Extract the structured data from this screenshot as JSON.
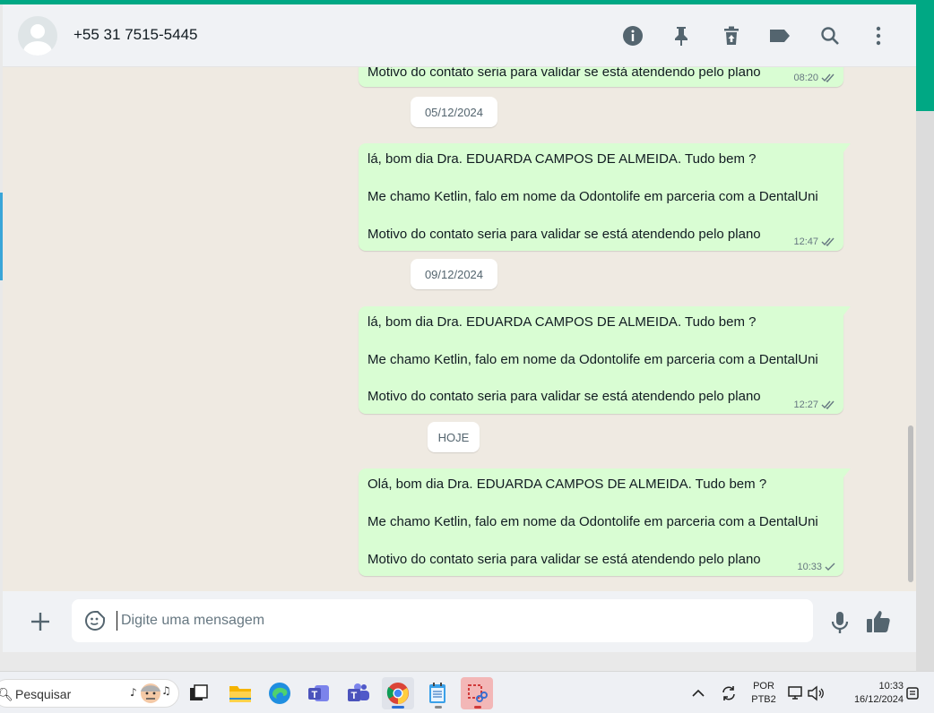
{
  "header": {
    "contact": "+55 31 7515-5445",
    "icons": [
      "info-icon",
      "pin-icon",
      "delete-icon",
      "label-icon",
      "search-icon",
      "more-icon"
    ]
  },
  "chat": {
    "partial_message": {
      "text": "Motivo do contato seria para validar se está atendendo pelo plano",
      "time": "08:20"
    },
    "groups": [
      {
        "date": "05/12/2024",
        "lines": [
          "lá, bom dia Dra. EDUARDA CAMPOS DE ALMEIDA. Tudo bem ?",
          "Me chamo Ketlin, falo em nome da Odontolife em parceria com a DentalUni",
          "Motivo do contato seria para validar se está atendendo pelo plano"
        ],
        "time": "12:47",
        "status": "read"
      },
      {
        "date": "09/12/2024",
        "lines": [
          "lá, bom dia Dra. EDUARDA CAMPOS DE ALMEIDA. Tudo bem ?",
          "Me chamo Ketlin, falo em nome da Odontolife em parceria com a DentalUni",
          "Motivo do contato seria para validar se está atendendo pelo plano"
        ],
        "time": "12:27",
        "status": "read"
      },
      {
        "date": "HOJE",
        "lines": [
          "Olá, bom dia Dra. EDUARDA CAMPOS DE ALMEIDA. Tudo bem ?",
          "Me chamo Ketlin, falo em nome da Odontolife em parceria com a DentalUni",
          "Motivo do contato seria para validar se está atendendo pelo plano"
        ],
        "time": "10:33",
        "status": "sent"
      }
    ]
  },
  "composer": {
    "placeholder": "Digite uma mensagem",
    "value": ""
  },
  "taskbar": {
    "search_label": "Pesquisar",
    "language": "POR",
    "layout": "PTB2",
    "time": "10:33",
    "date": "16/12/2024"
  },
  "colors": {
    "accent": "#00a884",
    "outgoing_bubble": "#d9fdd3",
    "chat_bg": "#efeae2",
    "read_tick": "#53bdeb"
  }
}
